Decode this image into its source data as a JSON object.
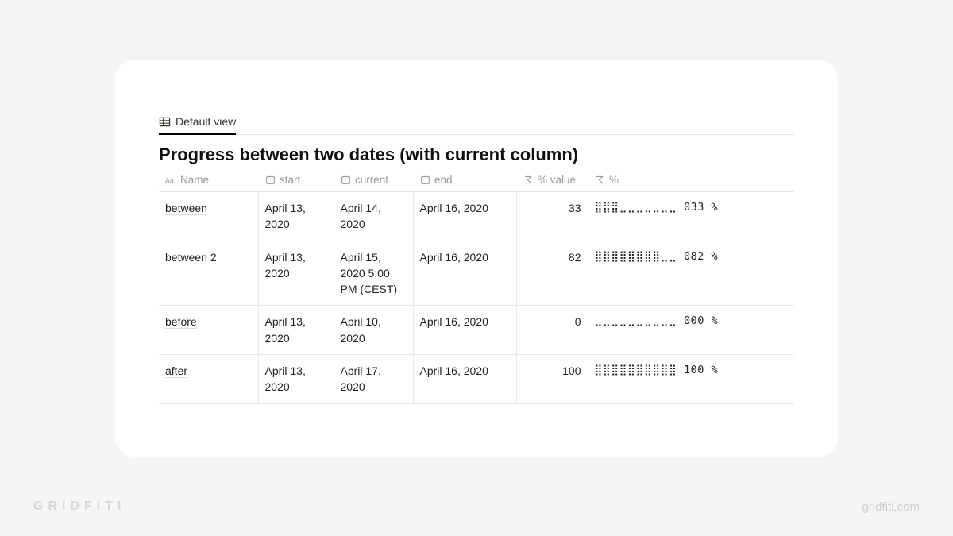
{
  "view_tab": {
    "label": "Default view"
  },
  "title": "Progress between two dates (with current column)",
  "columns": {
    "name": "Name",
    "start": "start",
    "current": "current",
    "end": "end",
    "value": "% value",
    "progress": "%"
  },
  "rows": [
    {
      "name": "between",
      "start": "April 13, 2020",
      "current": "April 14, 2020",
      "end": "April 16, 2020",
      "value": "33",
      "progress": "⣿⣿⣿⣀⣀⣀⣀⣀⣀⣀ 033 %"
    },
    {
      "name": "between 2",
      "start": "April 13, 2020",
      "current": "April 15, 2020 5:00 PM (CEST)",
      "end": "April 16, 2020",
      "value": "82",
      "progress": "⣿⣿⣿⣿⣿⣿⣿⣿⣀⣀ 082 %"
    },
    {
      "name": "before",
      "start": "April 13, 2020",
      "current": "April 10, 2020",
      "end": "April 16, 2020",
      "value": "0",
      "progress": "⣀⣀⣀⣀⣀⣀⣀⣀⣀⣀ 000 %"
    },
    {
      "name": "after",
      "start": "April 13, 2020",
      "current": "April 17, 2020",
      "end": "April 16, 2020",
      "value": "100",
      "progress": "⣿⣿⣿⣿⣿⣿⣿⣿⣿⣿ 100 %"
    }
  ],
  "footer": {
    "left": "GRIDFITI",
    "right": "gridfiti.com"
  }
}
